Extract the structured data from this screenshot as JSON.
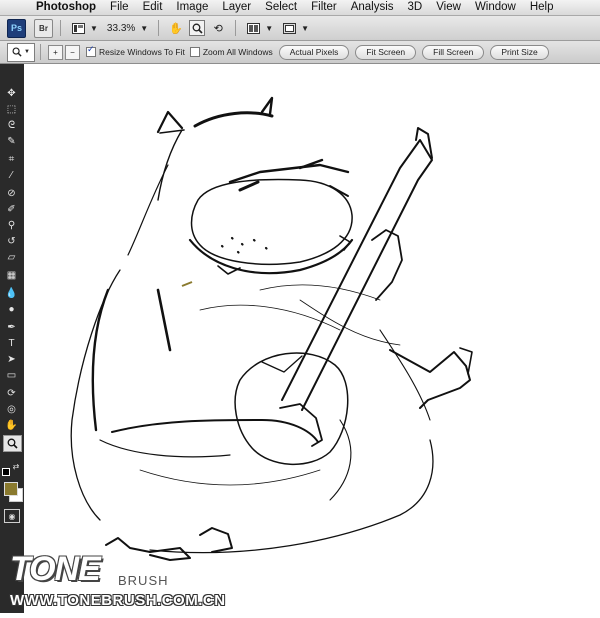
{
  "menubar": {
    "app_name": "Photoshop",
    "items": [
      "File",
      "Edit",
      "Image",
      "Layer",
      "Select",
      "Filter",
      "Analysis",
      "3D",
      "View",
      "Window",
      "Help"
    ]
  },
  "appbar": {
    "ps_badge": "Ps",
    "br_badge": "Br",
    "zoom_value": "33.3%"
  },
  "options": {
    "resize_windows_label": "Resize Windows To Fit",
    "resize_windows_checked": true,
    "zoom_all_windows_label": "Zoom All Windows",
    "zoom_all_windows_checked": false,
    "buttons": [
      "Actual Pixels",
      "Fit Screen",
      "Fill Screen",
      "Print Size"
    ]
  },
  "colors": {
    "foreground": "#8a7a2e",
    "background": "#ffffff",
    "toolbox_bg": "#2a2a2a"
  },
  "watermark": {
    "logo_text": "TONE",
    "logo_suffix": "BRUSH",
    "url": "WWW.TONEBRUSH.COM.CN"
  }
}
